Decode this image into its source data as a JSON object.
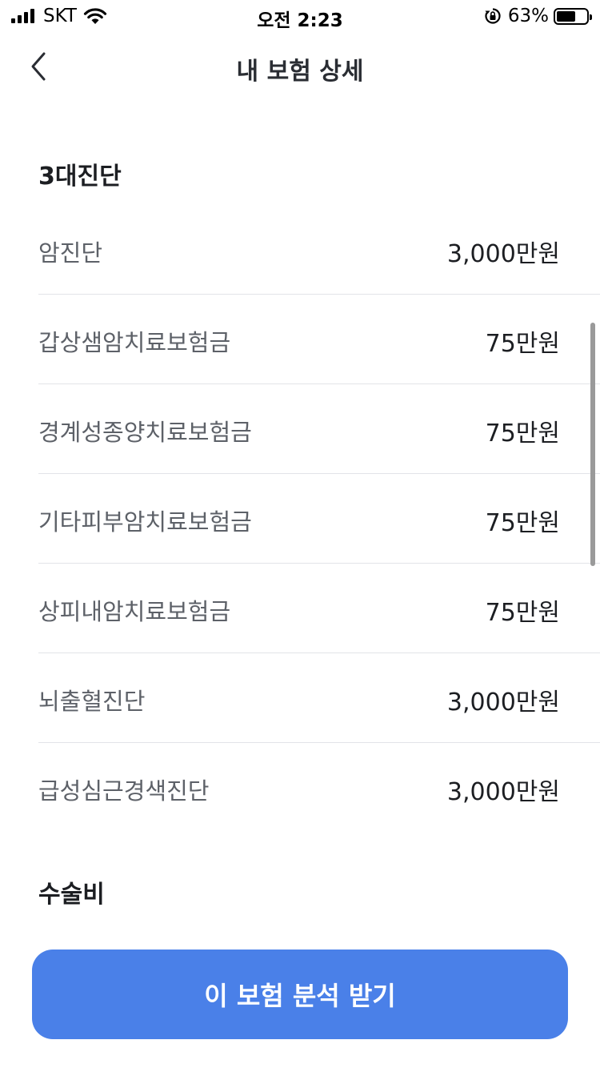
{
  "status_bar": {
    "carrier": "SKT",
    "time": "오전 2:23",
    "battery_percent": "63%",
    "battery_level": 0.63
  },
  "nav": {
    "title": "내 보험 상세",
    "back_icon": "chevron-left-icon"
  },
  "sections": [
    {
      "title": "3대진단",
      "items": [
        {
          "name": "암진단",
          "amount": "3,000만원"
        },
        {
          "name": "갑상샘암치료보험금",
          "amount": "75만원"
        },
        {
          "name": "경계성종양치료보험금",
          "amount": "75만원"
        },
        {
          "name": "기타피부암치료보험금",
          "amount": "75만원"
        },
        {
          "name": "상피내암치료보험금",
          "amount": "75만원"
        },
        {
          "name": "뇌출혈진단",
          "amount": "3,000만원"
        },
        {
          "name": "급성심근경색진단",
          "amount": "3,000만원"
        }
      ]
    },
    {
      "title": "수술비",
      "items": []
    }
  ],
  "cta": {
    "label": "이 보험 분석 받기",
    "color": "#4a80e8"
  }
}
